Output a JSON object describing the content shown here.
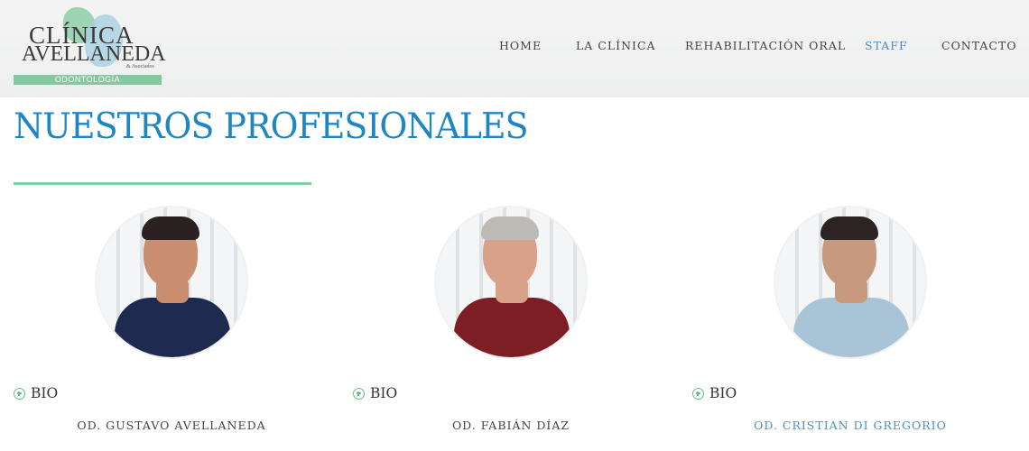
{
  "logo": {
    "line1": "CLÍNICA",
    "line2": "AVELLANEDA",
    "line3": "& Asociados",
    "bar_text": "ODONTOLOGÍA"
  },
  "nav": {
    "items": [
      {
        "label": "HOME",
        "active": false
      },
      {
        "label": "LA CLÍNICA",
        "active": false
      },
      {
        "label": "REHABILITACIÓN ORAL",
        "active": false
      },
      {
        "label": "STAFF",
        "active": true
      },
      {
        "label": "CONTACTO",
        "active": false
      }
    ]
  },
  "main": {
    "title": "NUESTROS PROFESIONALES"
  },
  "staff": [
    {
      "bio_label": "BIO",
      "name": "OD. GUSTAVO AVELLANEDA",
      "highlighted": false,
      "shirt_color": "#1e2a4f",
      "skin_color": "#c98e6f",
      "hair_color": "#2a2220"
    },
    {
      "bio_label": "BIO",
      "name": "OD. FABIÁN DÍAZ",
      "highlighted": false,
      "shirt_color": "#7d1e24",
      "skin_color": "#d9a08a",
      "hair_color": "#bdbab5"
    },
    {
      "bio_label": "BIO",
      "name": "OD. CRISTIAN DI GREGORIO",
      "highlighted": true,
      "shirt_color": "#a9c4d6",
      "skin_color": "#c79a80",
      "hair_color": "#2b2422"
    }
  ],
  "colors": {
    "accent_blue": "#1f86c4",
    "accent_green": "#7fd1a6",
    "active_link": "#4a8fc4"
  }
}
